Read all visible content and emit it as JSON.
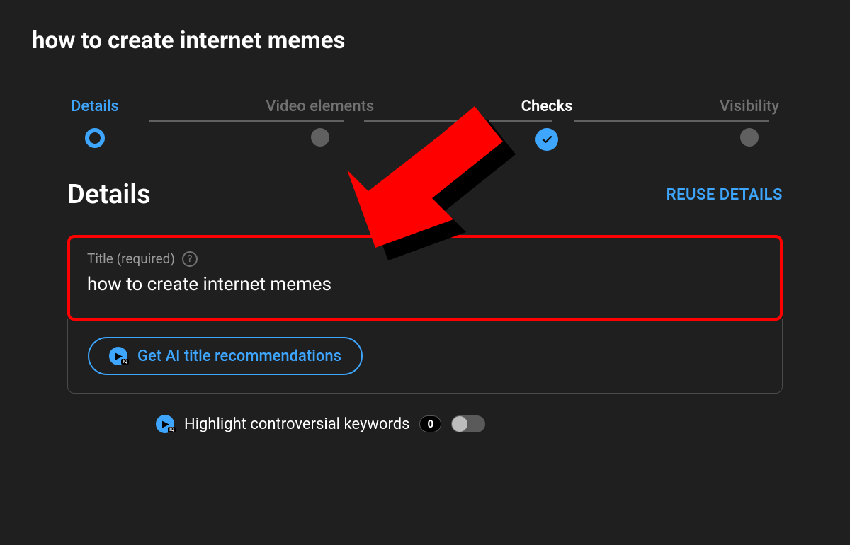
{
  "header": {
    "title": "how to create internet memes"
  },
  "stepper": {
    "steps": [
      {
        "label": "Details",
        "state": "active"
      },
      {
        "label": "Video elements",
        "state": "inactive"
      },
      {
        "label": "Checks",
        "state": "done"
      },
      {
        "label": "Visibility",
        "state": "inactive"
      }
    ]
  },
  "section": {
    "title": "Details",
    "reuse_label": "REUSE DETAILS"
  },
  "title_field": {
    "label": "Title (required)",
    "value": "how to create internet memes"
  },
  "ai_button": {
    "label": "Get AI title recommendations"
  },
  "highlight": {
    "label": "Highlight controversial keywords",
    "count": "0",
    "toggle": false
  },
  "colors": {
    "accent": "#3ea6ff",
    "annotation": "#ff0000"
  }
}
